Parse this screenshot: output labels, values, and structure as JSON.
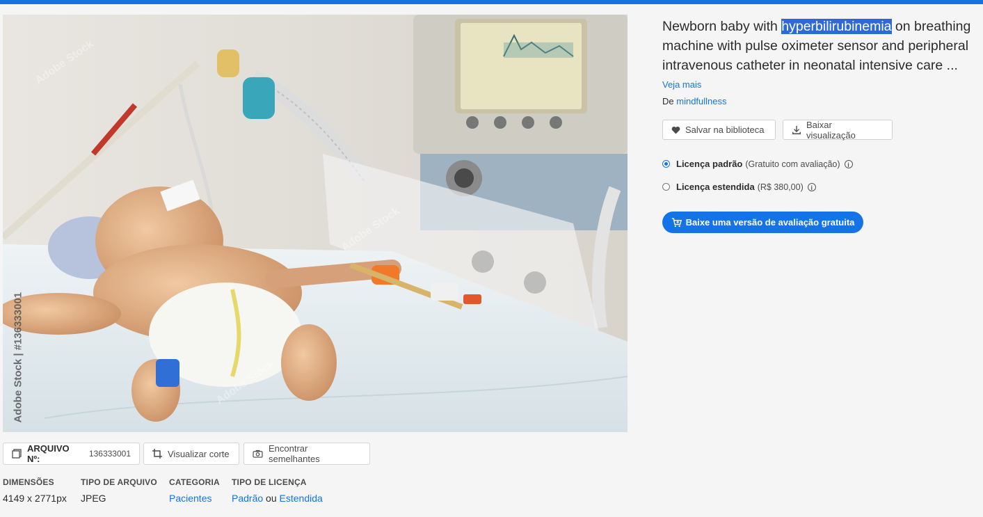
{
  "title": {
    "before": "Newborn baby with ",
    "highlight": "hyperbilirubinemia",
    "after": " on breathing machine with pulse oximeter sensor and peripheral intravenous catheter in neonatal intensive care ..."
  },
  "see_more": "Veja mais",
  "author": {
    "prefix": "De",
    "name": "mindfullness"
  },
  "actions": {
    "save": "Salvar na biblioteca",
    "download_preview": "Baixar visualização"
  },
  "licenses": [
    {
      "name": "Licença padrão",
      "note": "(Gratuito com avaliação)",
      "selected": true
    },
    {
      "name": "Licença estendida",
      "note": "(R$ 380,00)",
      "selected": false
    }
  ],
  "cta": "Baixe uma versão de avaliação gratuita",
  "watermark": "Adobe Stock | #136333001",
  "watermark_tile": "Adobe Stock",
  "toolbar": {
    "file_label": "ARQUIVO Nº:",
    "file_number": "136333001",
    "crop": "Visualizar corte",
    "similar": "Encontrar semelhantes"
  },
  "meta": {
    "dimensions_label": "DIMENSÕES",
    "dimensions_value": "4149 x 2771px",
    "filetype_label": "TIPO DE ARQUIVO",
    "filetype_value": "JPEG",
    "category_label": "CATEGORIA",
    "category_value": "Pacientes",
    "license_label": "TIPO DE LICENÇA",
    "license_standard": "Padrão",
    "license_or": "ou",
    "license_extended": "Estendida"
  },
  "colors": {
    "accent": "#1473e6",
    "highlight": "#2e6ad6",
    "background": "#f5f5f5"
  }
}
